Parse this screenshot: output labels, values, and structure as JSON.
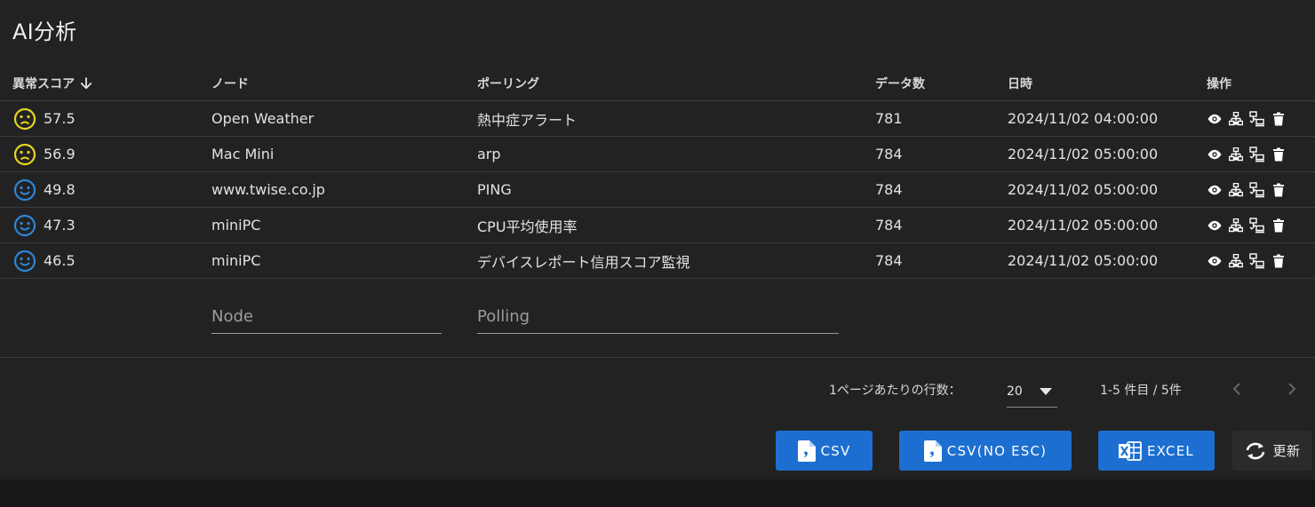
{
  "title": "AI分析",
  "columns": {
    "score": "異常スコア",
    "node": "ノード",
    "polling": "ポーリング",
    "count": "データ数",
    "datetime": "日時",
    "actions": "操作"
  },
  "rows": [
    {
      "face": "sad-face-icon",
      "score": "57.5",
      "node": "Open Weather",
      "polling": "熱中症アラート",
      "count": "781",
      "datetime": "2024/11/02 04:00:00"
    },
    {
      "face": "sad-face-icon",
      "score": "56.9",
      "node": "Mac Mini",
      "polling": "arp",
      "count": "784",
      "datetime": "2024/11/02 05:00:00"
    },
    {
      "face": "smile-face-icon",
      "score": "49.8",
      "node": "www.twise.co.jp",
      "polling": "PING",
      "count": "784",
      "datetime": "2024/11/02 05:00:00"
    },
    {
      "face": "smile-face-icon",
      "score": "47.3",
      "node": "miniPC",
      "polling": "CPU平均使用率",
      "count": "784",
      "datetime": "2024/11/02 05:00:00"
    },
    {
      "face": "smile-face-icon",
      "score": "46.5",
      "node": "miniPC",
      "polling": "デバイスレポート信用スコア監視",
      "count": "784",
      "datetime": "2024/11/02 05:00:00"
    }
  ],
  "filters": {
    "node_placeholder": "Node",
    "polling_placeholder": "Polling",
    "node_value": "",
    "polling_value": ""
  },
  "pagination": {
    "rows_per_page_label": "1ページあたりの行数：",
    "rows_per_page": "20",
    "range": "1-5 件目 / 5件"
  },
  "buttons": {
    "csv": "CSV",
    "csv_no_esc": "CSV(NO ESC)",
    "excel": "EXCEL",
    "refresh": "更新"
  },
  "colors": {
    "sad": "#e6d620",
    "smile": "#2e86d6",
    "primary": "#1c6fd0"
  }
}
